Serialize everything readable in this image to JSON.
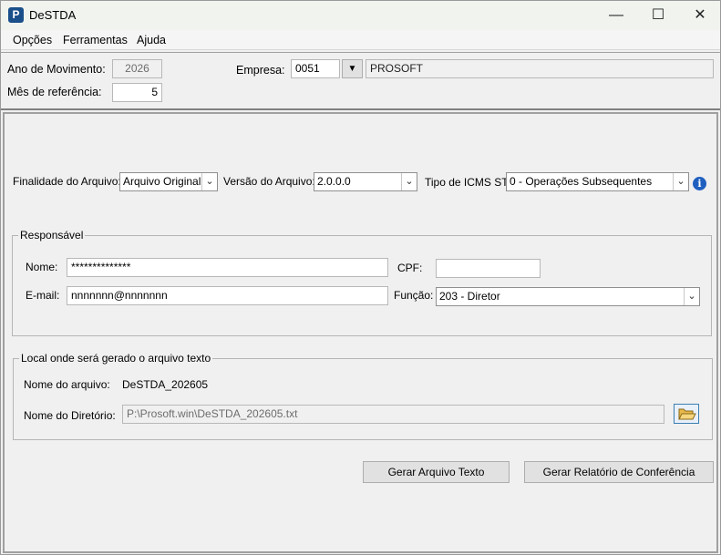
{
  "window": {
    "title": "DeSTDA",
    "icon": "P",
    "controls": {
      "minimize": "—",
      "maximize": "☐",
      "close": "✕"
    }
  },
  "menu": [
    "Opções",
    "Ferramentas",
    "Ajuda"
  ],
  "header": {
    "ano_label": "Ano de Movimento:",
    "ano_value": "2026",
    "mes_label": "Mês de referência:",
    "mes_value": "5",
    "empresa_label": "Empresa:",
    "empresa_code": "0051",
    "empresa_name": "PROSOFT"
  },
  "arquivo": {
    "finalidade_label": "Finalidade do Arquivo:",
    "finalidade_value": "Arquivo Original",
    "versao_label": "Versão do Arquivo:",
    "versao_value": "2.0.0.0",
    "icms_label": "Tipo de ICMS ST:",
    "icms_value": "0 - Operações Subsequentes"
  },
  "responsavel": {
    "title": "Responsável",
    "nome_label": "Nome:",
    "nome_value": "**************",
    "cpf_label": "CPF:",
    "cpf_value": "",
    "email_label": "E-mail:",
    "email_value": "nnnnnnn@nnnnnnn",
    "funcao_label": "Função:",
    "funcao_value": "203 - Diretor"
  },
  "local": {
    "title": "Local onde será gerado o arquivo texto",
    "nome_arquivo_label": "Nome do arquivo:",
    "nome_arquivo_value": "DeSTDA_202605",
    "diretorio_label": "Nome do Diretório:",
    "diretorio_value": "P:\\Prosoft.win\\DeSTDA_202605.txt"
  },
  "buttons": {
    "gerar_texto": "Gerar Arquivo Texto",
    "gerar_relatorio": "Gerar Relatório de Conferência"
  }
}
